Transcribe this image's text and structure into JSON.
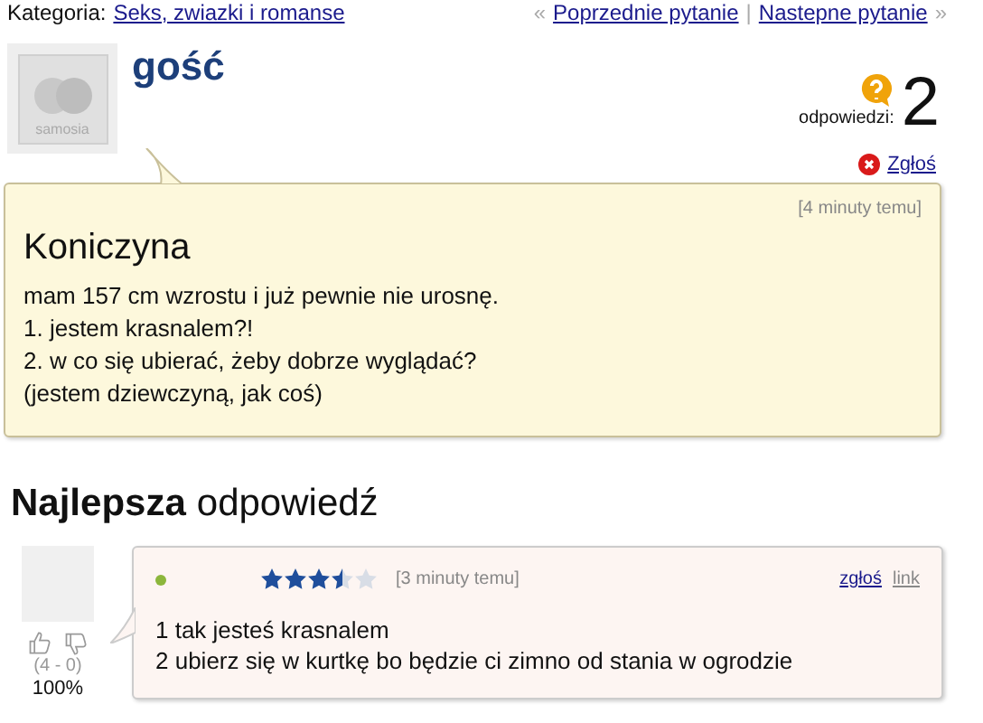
{
  "breadcrumb": {
    "label": "Kategoria:",
    "category": "Seks, zwiazki i romanse"
  },
  "nav": {
    "prev_mark": "«",
    "prev": "Poprzednie pytanie",
    "separator": "|",
    "next": "Nastepne pytanie",
    "next_mark": "»"
  },
  "asker": {
    "name": "gość",
    "avatar_text": "samosia"
  },
  "answers_count": {
    "label": "odpowiedzi:",
    "value": "2"
  },
  "report": "Zgłoś",
  "question": {
    "time": "[4 minuty temu]",
    "title": "Koniczyna",
    "lines": [
      "mam 157 cm wzrostu i już pewnie nie urosnę.",
      "1. jestem krasnalem?!",
      "2. w co się ubierać, żeby dobrze wyglądać?",
      "(jestem dziewczyną, jak coś)"
    ]
  },
  "best_answer": {
    "heading_bold": "Najlepsza",
    "heading_rest": "odpowiedź",
    "online": true,
    "stars": 3.5,
    "time": "[3 minuty temu]",
    "report": "zgłoś",
    "link": "link",
    "votes": "(4 - 0)",
    "percent": "100%",
    "lines": [
      "1 tak jesteś krasnalem",
      "2 ubierz się w kurtkę bo będzie ci zimno od stania w ogrodzie"
    ]
  }
}
